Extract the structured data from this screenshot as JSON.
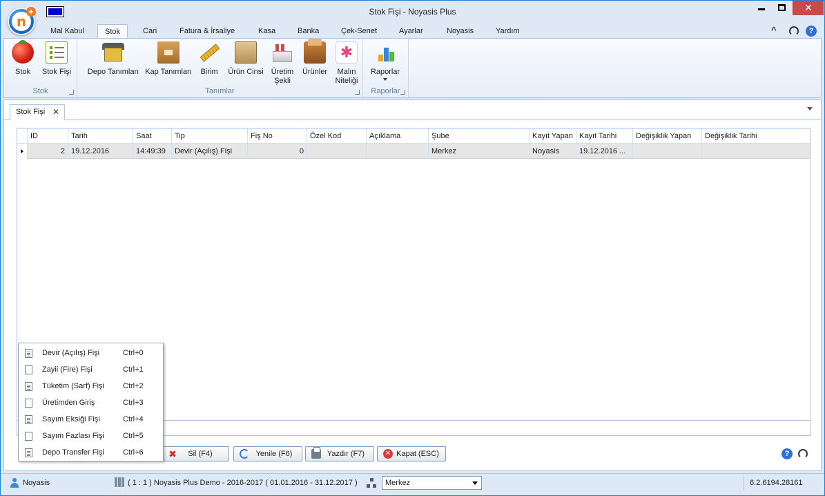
{
  "window": {
    "title": "Stok Fişi - Noyasis Plus",
    "close_glyph": "✕"
  },
  "app_logo": {
    "letter": "n",
    "plus": "+"
  },
  "ribbon": {
    "tabs": [
      {
        "label": "Mal Kabul"
      },
      {
        "label": "Stok"
      },
      {
        "label": "Cari"
      },
      {
        "label": "Fatura & İrsaliye"
      },
      {
        "label": "Kasa"
      },
      {
        "label": "Banka"
      },
      {
        "label": "Çek-Senet"
      },
      {
        "label": "Ayarlar"
      },
      {
        "label": "Noyasis"
      },
      {
        "label": "Yardım"
      }
    ],
    "active_tab": "Stok",
    "groups": {
      "stok": {
        "label": "Stok",
        "buttons": [
          {
            "label": "Stok",
            "icon": "tomato-icon"
          },
          {
            "label": "Stok Fişi",
            "icon": "list-icon"
          }
        ]
      },
      "tanimlar": {
        "label": "Tanımlar",
        "buttons": [
          {
            "label": "Depo Tanımları",
            "icon": "warehouse-icon"
          },
          {
            "label": "Kap Tanımları",
            "icon": "box-icon"
          },
          {
            "label": "Birim",
            "icon": "ruler-icon"
          },
          {
            "label": "Ürün Cinsi",
            "icon": "crate-icon"
          },
          {
            "label": "Üretim Şekli",
            "icon": "factory-icon"
          },
          {
            "label": "Ürünler",
            "icon": "parcel-icon"
          },
          {
            "label": "Malın Niteliği",
            "icon": "star-icon"
          }
        ]
      },
      "raporlar": {
        "label": "Raporlar",
        "buttons": [
          {
            "label": "Raporlar",
            "icon": "chart-icon"
          }
        ]
      }
    }
  },
  "document_tab": {
    "label": "Stok Fişi",
    "close_glyph": "✕"
  },
  "grid": {
    "columns": [
      "ID",
      "Tarih",
      "Saat",
      "Tip",
      "Fiş No",
      "Özel Kod",
      "Açıklama",
      "Şube",
      "Kayıt Yapan",
      "Kayıt Tarihi",
      "Değişiklik Yapan",
      "Değişiklik Tarihi"
    ],
    "rows": [
      {
        "id": "2",
        "tarih": "19.12.2016",
        "saat": "14:49:39",
        "tip": "Devir (Açılış) Fişi",
        "fis_no": "0",
        "ozel_kod": "",
        "aciklama": "",
        "sube": "Merkez",
        "kayit_yapan": "Noyasis",
        "kayit_tarihi": "19.12.2016 ...",
        "degisiklik_yapan": "",
        "degisiklik_tarihi": ""
      }
    ]
  },
  "context_menu": {
    "items": [
      {
        "label": "Devir (Açılış) Fişi",
        "shortcut": "Ctrl+0"
      },
      {
        "label": "Zayii (Fire) Fişi",
        "shortcut": "Ctrl+1"
      },
      {
        "label": "Tüketim (Sarf) Fişi",
        "shortcut": "Ctrl+2"
      },
      {
        "label": "Üretimden Giriş",
        "shortcut": "Ctrl+3"
      },
      {
        "label": "Sayım Eksiği Fişi",
        "shortcut": "Ctrl+4"
      },
      {
        "label": "Sayım Fazlası Fişi",
        "shortcut": "Ctrl+5"
      },
      {
        "label": "Depo Transfer Fişi",
        "shortcut": "Ctrl+6"
      }
    ]
  },
  "actions": {
    "delete": "Sil (F4)",
    "refresh": "Yenile (F6)",
    "print": "Yazdır (F7)",
    "close": "Kapat (ESC)",
    "help_glyph": "?"
  },
  "status_bar": {
    "user": "Noyasis",
    "company_info": "( 1 : 1 )  Noyasis Plus Demo - 2016-2017  ( 01.01.2016 - 31.12.2017 )",
    "branch_selected": "Merkez",
    "version": "6.2.6194.28161"
  },
  "colors": {
    "accent_blue": "#1883d7",
    "close_red": "#c74b4b",
    "selected_row": "#e6e6e6"
  }
}
